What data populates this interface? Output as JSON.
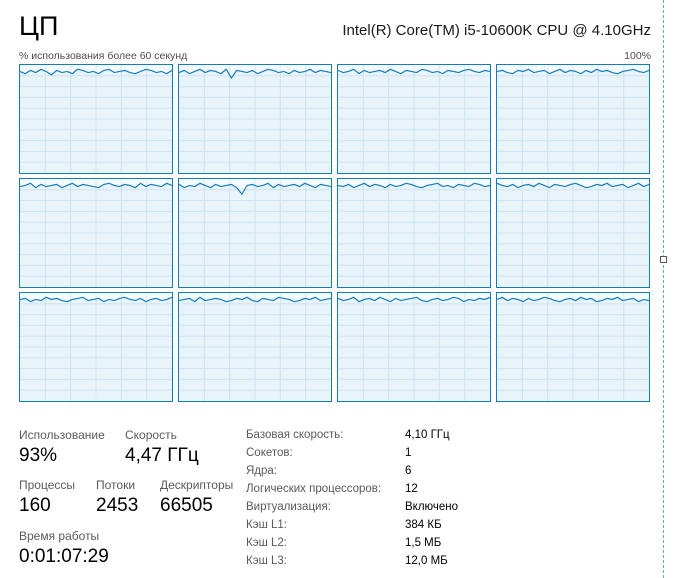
{
  "header": {
    "title": "ЦП",
    "cpu_name": "Intel(R) Core(TM) i5-10600K CPU @ 4.10GHz",
    "axis_label_left": "% использования более 60 секунд",
    "axis_label_right": "100%"
  },
  "cores": [
    {
      "usage": [
        94,
        92,
        95,
        93,
        96,
        94,
        91,
        95,
        93,
        94,
        92,
        96,
        95,
        93,
        94,
        92,
        95,
        96,
        93,
        94,
        95,
        93,
        92,
        94,
        96,
        95,
        93,
        94,
        92,
        95
      ]
    },
    {
      "usage": [
        93,
        95,
        92,
        94,
        96,
        93,
        95,
        94,
        92,
        96,
        88,
        95,
        94,
        93,
        95,
        92,
        94,
        96,
        95,
        93,
        94,
        92,
        95,
        93,
        94,
        96,
        93,
        95,
        94,
        93
      ]
    },
    {
      "usage": [
        95,
        93,
        94,
        96,
        92,
        95,
        93,
        94,
        95,
        93,
        96,
        94,
        92,
        95,
        94,
        93,
        96,
        95,
        93,
        94,
        92,
        95,
        94,
        93,
        95,
        96,
        94,
        93,
        95,
        94
      ]
    },
    {
      "usage": [
        94,
        95,
        93,
        92,
        95,
        94,
        96,
        93,
        94,
        95,
        92,
        94,
        96,
        93,
        95,
        94,
        92,
        95,
        93,
        96,
        94,
        95,
        93,
        92,
        94,
        95,
        96,
        94,
        93,
        95
      ]
    },
    {
      "usage": [
        93,
        94,
        96,
        92,
        95,
        93,
        94,
        95,
        92,
        94,
        96,
        93,
        95,
        94,
        93,
        92,
        95,
        96,
        94,
        93,
        95,
        94,
        92,
        96,
        93,
        95,
        94,
        93,
        96,
        94
      ]
    },
    {
      "usage": [
        95,
        92,
        94,
        93,
        96,
        94,
        92,
        95,
        93,
        94,
        95,
        92,
        86,
        94,
        95,
        93,
        94,
        96,
        92,
        95,
        93,
        94,
        95,
        93,
        96,
        94,
        92,
        95,
        94,
        93
      ]
    },
    {
      "usage": [
        94,
        93,
        95,
        92,
        94,
        96,
        93,
        95,
        94,
        92,
        95,
        93,
        94,
        96,
        95,
        93,
        92,
        94,
        95,
        96,
        93,
        94,
        92,
        95,
        94,
        93,
        96,
        95,
        93,
        94
      ]
    },
    {
      "usage": [
        96,
        94,
        93,
        95,
        92,
        94,
        95,
        93,
        96,
        94,
        92,
        95,
        94,
        93,
        95,
        96,
        94,
        92,
        93,
        95,
        94,
        96,
        93,
        94,
        95,
        92,
        94,
        96,
        93,
        95
      ]
    },
    {
      "usage": [
        94,
        95,
        92,
        94,
        93,
        96,
        94,
        95,
        93,
        92,
        94,
        95,
        96,
        93,
        94,
        95,
        92,
        94,
        93,
        95,
        96,
        94,
        93,
        95,
        92,
        94,
        95,
        93,
        94,
        96
      ]
    },
    {
      "usage": [
        93,
        94,
        95,
        92,
        96,
        93,
        94,
        95,
        94,
        92,
        93,
        95,
        94,
        96,
        93,
        92,
        95,
        94,
        93,
        96,
        95,
        94,
        92,
        93,
        95,
        94,
        96,
        93,
        94,
        95
      ]
    },
    {
      "usage": [
        95,
        93,
        94,
        96,
        92,
        94,
        95,
        93,
        96,
        94,
        92,
        95,
        93,
        94,
        95,
        96,
        93,
        92,
        94,
        95,
        93,
        94,
        96,
        95,
        92,
        94,
        93,
        95,
        94,
        96
      ]
    },
    {
      "usage": [
        94,
        96,
        93,
        95,
        94,
        92,
        95,
        93,
        94,
        96,
        95,
        93,
        92,
        94,
        95,
        93,
        96,
        94,
        95,
        92,
        93,
        95,
        94,
        96,
        93,
        94,
        95,
        92,
        94,
        93
      ]
    }
  ],
  "stats": {
    "usage_label": "Использование",
    "usage_value": "93%",
    "speed_label": "Скорость",
    "speed_value": "4,47 ГГц",
    "processes_label": "Процессы",
    "processes_value": "160",
    "threads_label": "Потоки",
    "threads_value": "2453",
    "handles_label": "Дескрипторы",
    "handles_value": "66505",
    "uptime_label": "Время работы",
    "uptime_value": "0:01:07:29"
  },
  "specs": [
    {
      "key": "Базовая скорость:",
      "value": "4,10 ГГц"
    },
    {
      "key": "Сокетов:",
      "value": "1"
    },
    {
      "key": "Ядра:",
      "value": "6"
    },
    {
      "key": "Логических процессоров:",
      "value": "12"
    },
    {
      "key": "Виртуализация:",
      "value": "Включено"
    },
    {
      "key": "Кэш L1:",
      "value": "384 КБ"
    },
    {
      "key": "Кэш L2:",
      "value": "1,5 МБ"
    },
    {
      "key": "Кэш L3:",
      "value": "12,0 МБ"
    }
  ],
  "colors": {
    "accent": "#117dbb",
    "graph_fill": "#f4fafd",
    "grid": "#d9eaf4"
  }
}
